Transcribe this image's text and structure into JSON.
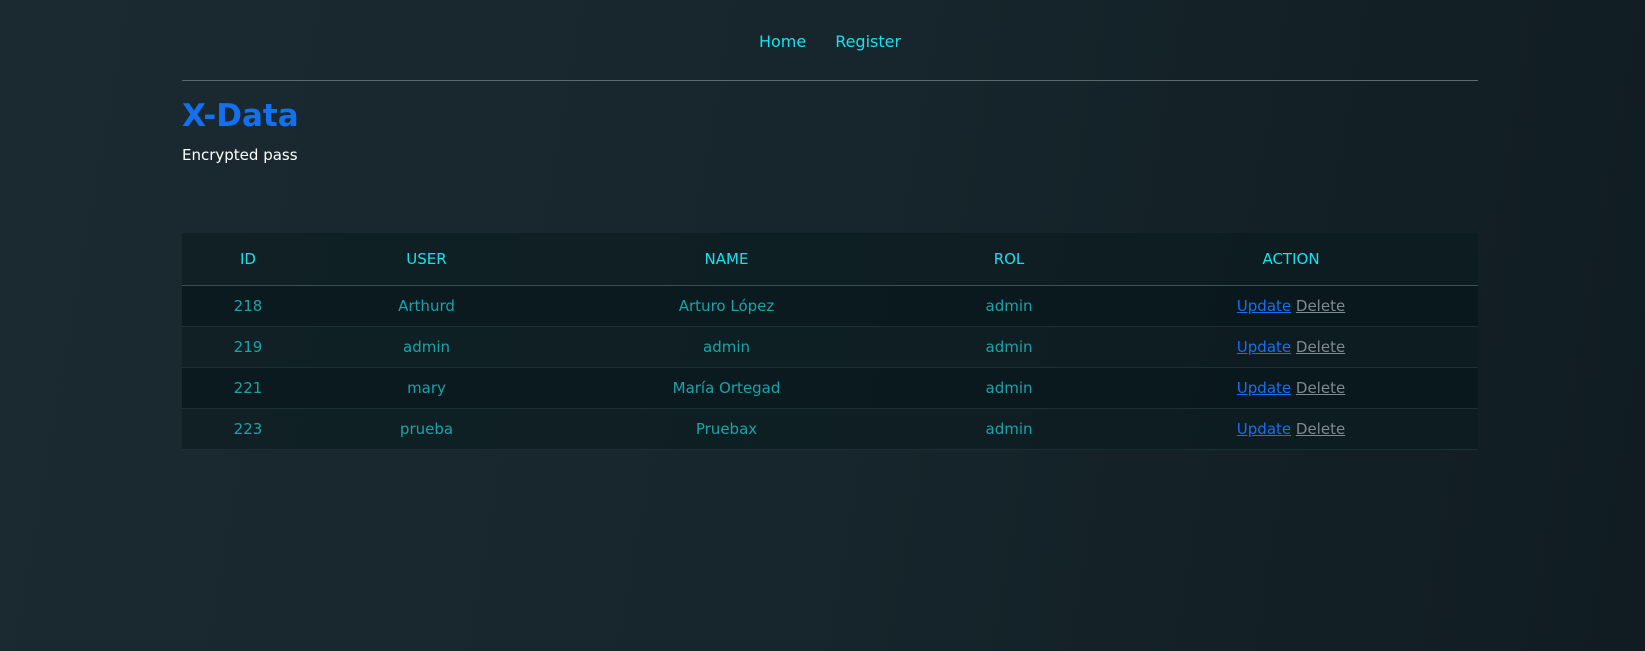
{
  "nav": {
    "links": [
      {
        "label": "Home"
      },
      {
        "label": "Register"
      }
    ]
  },
  "header": {
    "title": "X-Data",
    "subtitle": "Encrypted pass"
  },
  "table": {
    "columns": [
      "ID",
      "USER",
      "NAME",
      "ROL",
      "ACTION"
    ],
    "rows": [
      {
        "id": "218",
        "user": "Arthurd",
        "name": "Arturo López",
        "rol": "admin",
        "update": "Update",
        "delete": "Delete"
      },
      {
        "id": "219",
        "user": "admin",
        "name": "admin",
        "rol": "admin",
        "update": "Update",
        "delete": "Delete"
      },
      {
        "id": "221",
        "user": "mary",
        "name": "María Ortegad",
        "rol": "admin",
        "update": "Update",
        "delete": "Delete"
      },
      {
        "id": "223",
        "user": "prueba",
        "name": "Pruebax",
        "rol": "admin",
        "update": "Update",
        "delete": "Delete"
      }
    ]
  },
  "colors": {
    "accent": "#19e0f0",
    "brand": "#1570f0",
    "cell_text": "#19a4a8",
    "delete_link": "#7d8a8e"
  }
}
